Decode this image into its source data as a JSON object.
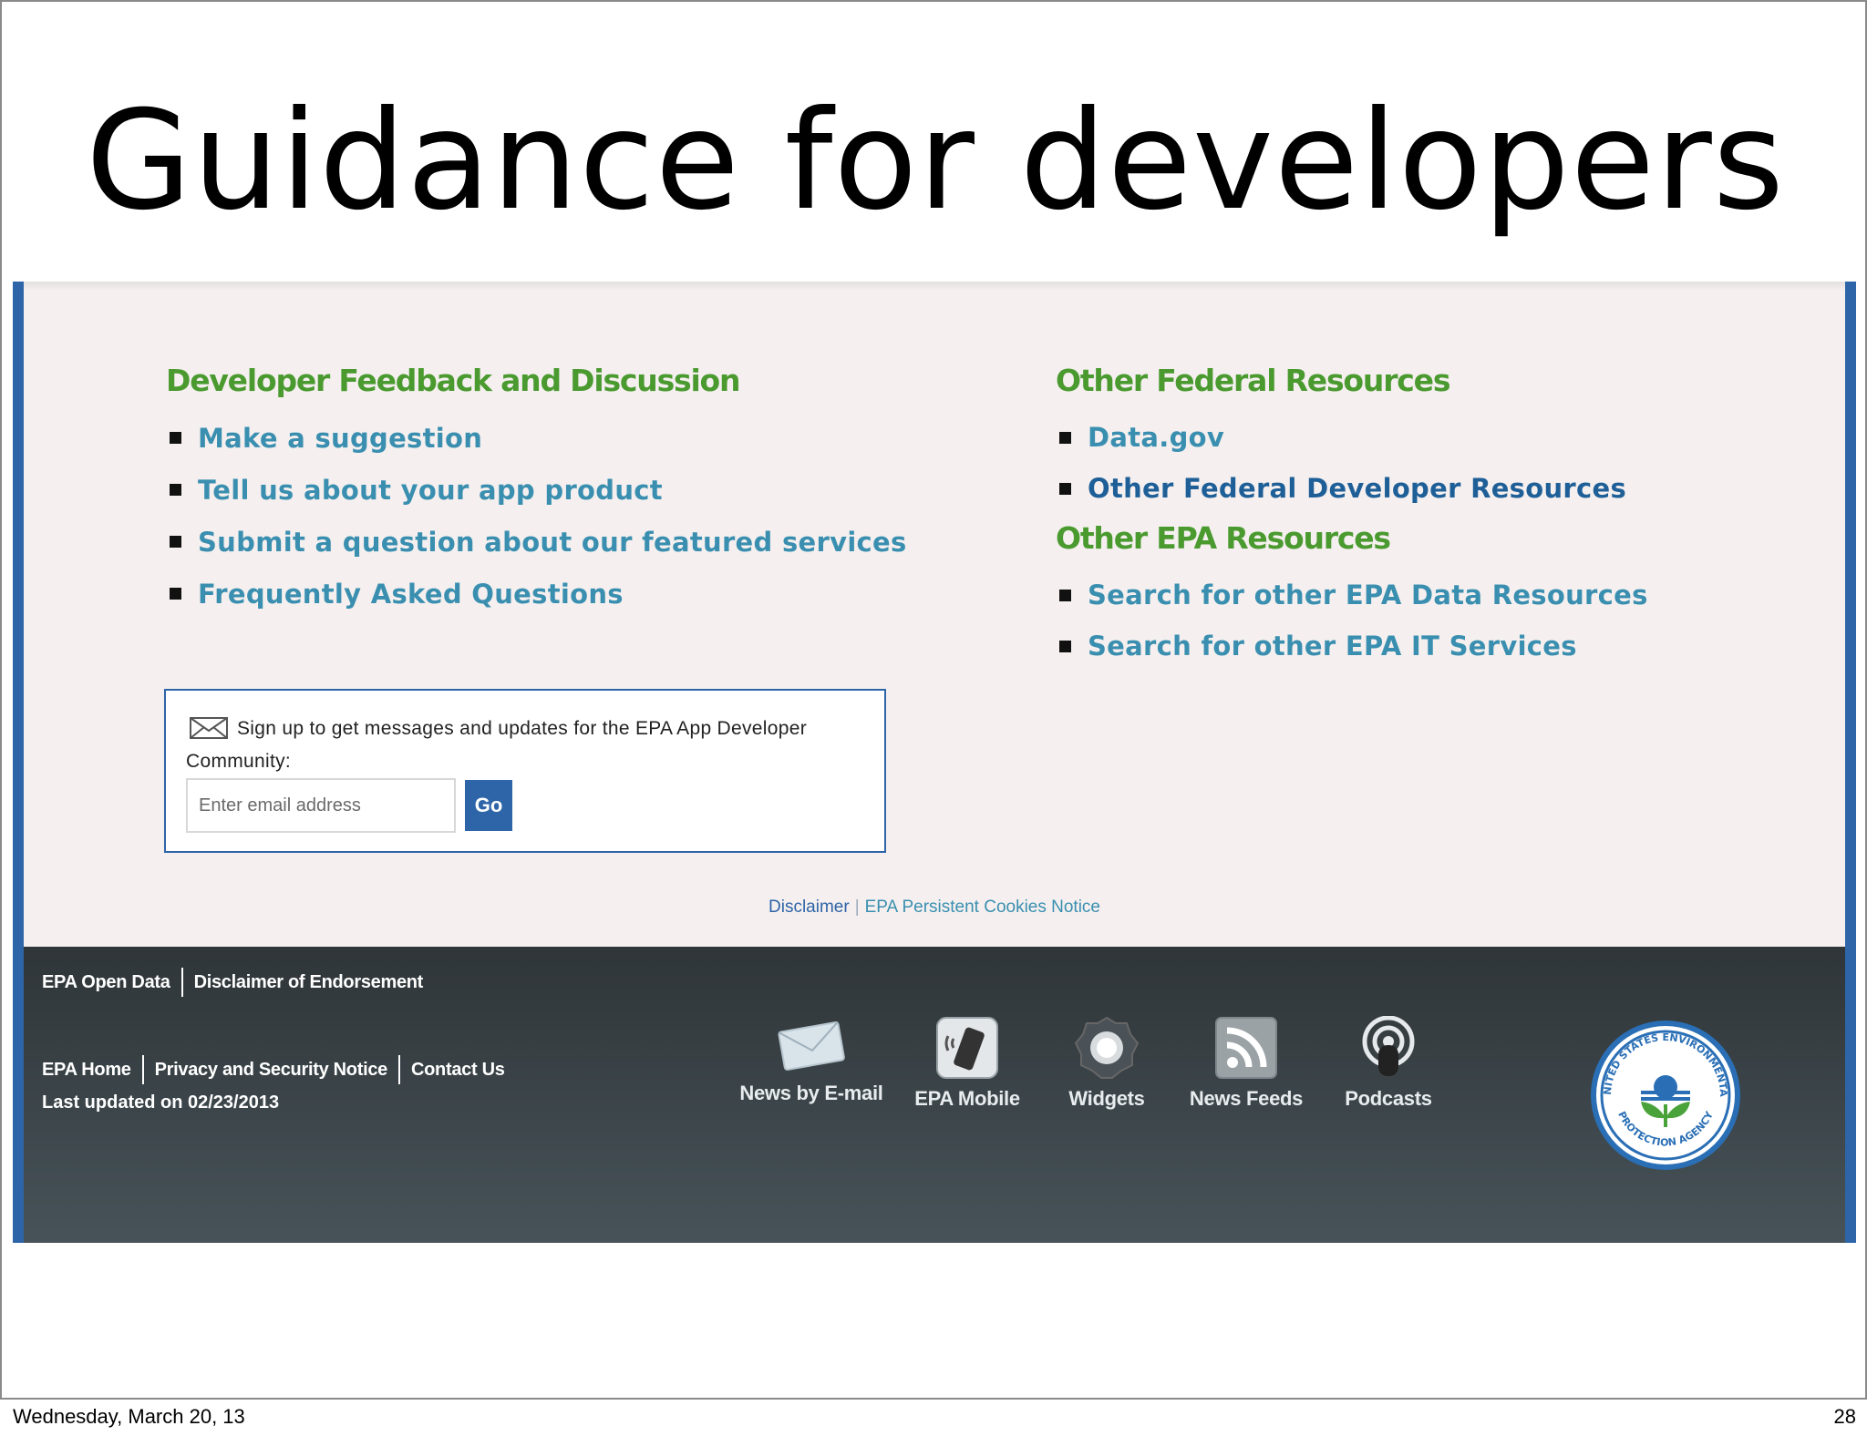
{
  "slide": {
    "title": "Guidance for developers",
    "date": "Wednesday, March 20, 13",
    "page_number": "28"
  },
  "left_section": {
    "heading": "Developer Feedback and Discussion",
    "links": [
      "Make a suggestion",
      "Tell us about your app product",
      "Submit a question about our featured services",
      "Frequently Asked Questions"
    ]
  },
  "right_section": {
    "federal_heading": "Other Federal Resources",
    "federal_links": [
      "Data.gov",
      "Other Federal Developer Resources"
    ],
    "epa_heading": "Other EPA Resources",
    "epa_links": [
      "Search for other EPA Data Resources",
      "Search for other EPA IT Services"
    ]
  },
  "signup": {
    "text": "Sign up to get messages and updates for the EPA App Developer Community:",
    "placeholder": "Enter email address",
    "go_label": "Go"
  },
  "legal": {
    "disclaimer": "Disclaimer",
    "separator": "|",
    "cookies": "EPA Persistent Cookies Notice"
  },
  "footer": {
    "row1": [
      "EPA Open Data",
      "Disclaimer of Endorsement"
    ],
    "row2": [
      "EPA Home",
      "Privacy and Security Notice",
      "Contact Us"
    ],
    "last_updated": "Last updated on 02/23/2013",
    "icons": [
      {
        "label": "News by E-mail",
        "icon": "envelope-icon"
      },
      {
        "label": "EPA Mobile",
        "icon": "mobile-phone-icon"
      },
      {
        "label": "Widgets",
        "icon": "widget-gear-icon"
      },
      {
        "label": "News Feeds",
        "icon": "rss-icon"
      },
      {
        "label": "Podcasts",
        "icon": "podcast-icon"
      }
    ]
  },
  "colors": {
    "heading_green": "#4a9a30",
    "link_blue": "#3a8fb0",
    "link_dark_blue": "#1f5f98",
    "border_blue": "#2e65a8",
    "footer_dark": "#2f3538"
  }
}
